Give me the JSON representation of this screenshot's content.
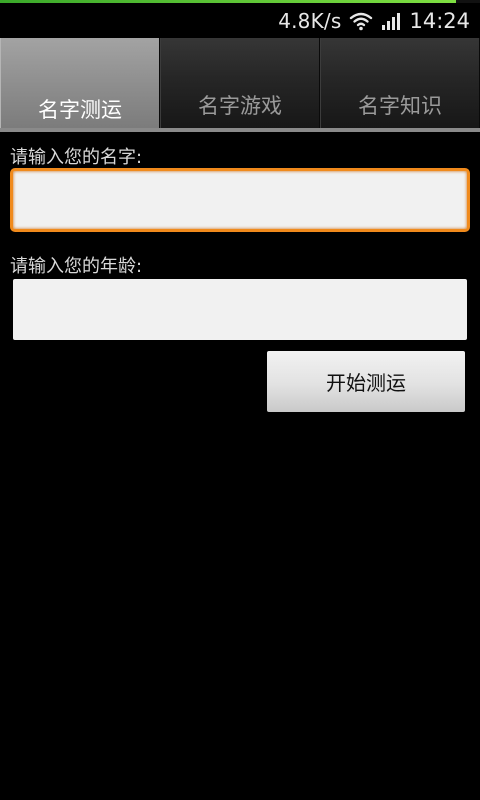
{
  "status_bar": {
    "net_speed": "4.8K/s",
    "time": "14:24",
    "wifi_icon": "wifi-icon",
    "signal_icon": "signal-icon"
  },
  "top_progress": {
    "fraction": 0.95,
    "color": "#5cc536"
  },
  "tabs": [
    {
      "label": "名字测运",
      "active": true
    },
    {
      "label": "名字游戏",
      "active": false
    },
    {
      "label": "名字知识",
      "active": false
    }
  ],
  "form": {
    "name_label": "请输入您的名字:",
    "name_value": "",
    "age_label": "请输入您的年龄:",
    "age_value": "",
    "start_button_label": "开始测运"
  },
  "colors": {
    "focus_border": "#f08a1c",
    "active_tab": "#8e8e8e",
    "background": "#000000"
  }
}
